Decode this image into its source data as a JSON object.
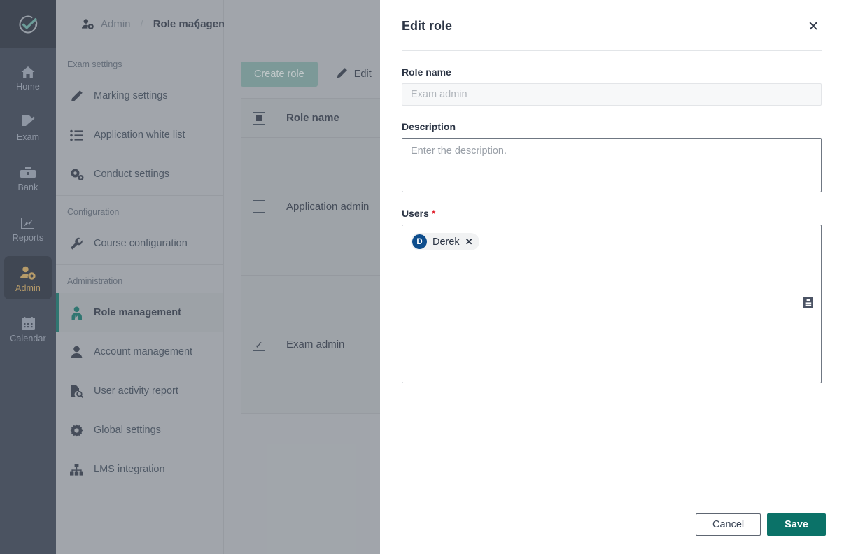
{
  "app": {
    "logo_icon": "circle-check-logo",
    "accent_teal": "#0b7268",
    "rail_bg": "#343d50",
    "admin_highlight": "#d6aa5c"
  },
  "rail": {
    "items": [
      {
        "label": "Home",
        "icon": "home-icon",
        "active": false
      },
      {
        "label": "Exam",
        "icon": "exam-icon",
        "active": false
      },
      {
        "label": "Bank",
        "icon": "bank-icon",
        "active": false
      },
      {
        "label": "Reports",
        "icon": "reports-icon",
        "active": false
      },
      {
        "label": "Admin",
        "icon": "admin-icon",
        "active": true
      },
      {
        "label": "Calendar",
        "icon": "calendar-icon",
        "active": false
      }
    ]
  },
  "sidebar": {
    "collapse_icon": "chevron-left-icon",
    "groups": [
      {
        "title": "Exam settings",
        "items": [
          {
            "label": "Marking settings",
            "icon": "pencil-icon",
            "active": false
          },
          {
            "label": "Application white list",
            "icon": "list-icon",
            "active": false
          },
          {
            "label": "Conduct settings",
            "icon": "gears-icon",
            "active": false
          }
        ]
      },
      {
        "title": "Configuration",
        "items": [
          {
            "label": "Course configuration",
            "icon": "wrench-icon",
            "active": false
          }
        ]
      },
      {
        "title": "Administration",
        "items": [
          {
            "label": "Role management",
            "icon": "user-tie-icon",
            "active": true
          },
          {
            "label": "Account management",
            "icon": "user-icon",
            "active": false
          },
          {
            "label": "User activity report",
            "icon": "file-search-icon",
            "active": false
          },
          {
            "label": "Global settings",
            "icon": "gear-icon",
            "active": false
          },
          {
            "label": "LMS integration",
            "icon": "sitemap-icon",
            "active": false
          }
        ]
      }
    ]
  },
  "breadcrumb": {
    "icon": "admin-icon",
    "parent": "Admin",
    "separator": "/",
    "current": "Role management"
  },
  "toolbar": {
    "create_label": "Create role",
    "edit_label": "Edit",
    "edit_icon": "pencil-icon"
  },
  "table": {
    "header_checkbox_state": "indeterminate",
    "columns": [
      "Role name"
    ],
    "rows": [
      {
        "name": "Application admin",
        "checked": false
      },
      {
        "name": "Exam admin",
        "checked": true
      }
    ]
  },
  "modal": {
    "title": "Edit role",
    "close_icon": "close-icon",
    "role_name": {
      "label": "Role name",
      "value": "Exam admin",
      "disabled": true
    },
    "description": {
      "label": "Description",
      "value": "",
      "placeholder": "Enter the description."
    },
    "users": {
      "label": "Users",
      "required_marker": "*",
      "picker_icon": "contact-card-icon",
      "chips": [
        {
          "initial": "D",
          "name": "Derek",
          "remove_icon": "close-icon"
        }
      ]
    },
    "cancel_label": "Cancel",
    "save_label": "Save"
  }
}
